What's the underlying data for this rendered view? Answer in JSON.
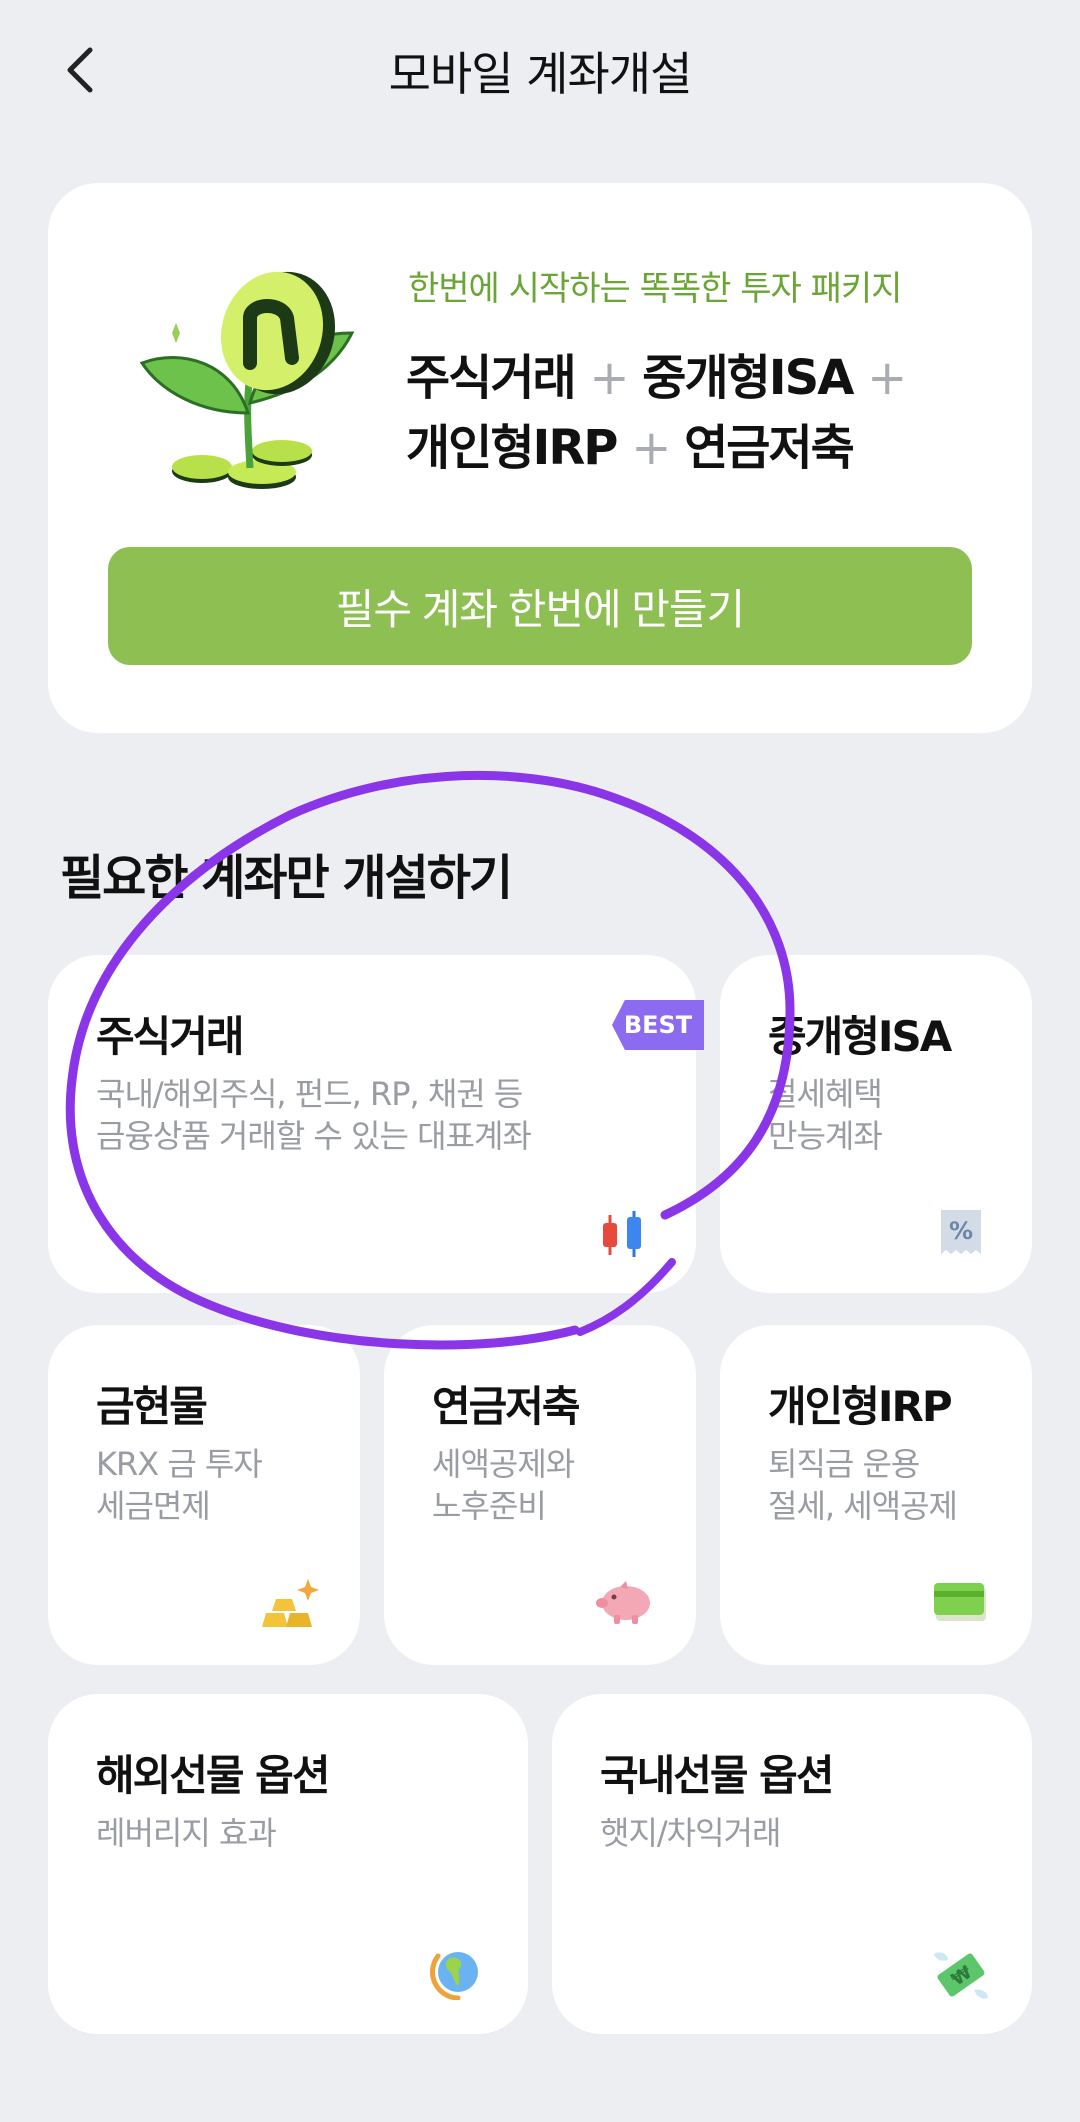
{
  "header": {
    "title": "모바일 계좌개설"
  },
  "package": {
    "subtitle": "한번에 시작하는 똑똑한 투자 패키지",
    "line1_part1": "주식거래",
    "line1_part2": "중개형ISA",
    "line2_part1": "개인형IRP",
    "line2_part2": "연금저축",
    "plus": "+",
    "button_label": "필수 계좌 한번에 만들기"
  },
  "section": {
    "title": "필요한 계좌만 개설하기"
  },
  "tiles": [
    {
      "title": "주식거래",
      "desc": "국내/해외주식, 펀드, RP, 채권 등\n금융상품 거래할 수 있는 대표계좌",
      "badge": "BEST",
      "icon": "candlestick-chart-icon"
    },
    {
      "title": "중개형ISA",
      "desc": "절세혜택\n만능계좌",
      "icon": "percent-receipt-icon"
    },
    {
      "title": "금현물",
      "desc": "KRX 금 투자\n세금면제",
      "icon": "gold-bar-icon"
    },
    {
      "title": "연금저축",
      "desc": "세액공제와\n노후준비",
      "icon": "piggy-bank-icon"
    },
    {
      "title": "개인형IRP",
      "desc": "퇴직금 운용\n절세, 세액공제",
      "icon": "card-icon"
    },
    {
      "title": "해외선물 옵션",
      "desc": "레버리지 효과",
      "icon": "globe-icon"
    },
    {
      "title": "국내선물 옵션",
      "desc": "햇지/차익거래",
      "icon": "money-wings-icon"
    }
  ],
  "colors": {
    "background": "#eceef2",
    "accent_green": "#8ebf52",
    "subtitle_green": "#6aa536",
    "badge_purple": "#8d6bf0",
    "annotation_purple": "#8a35e8"
  }
}
